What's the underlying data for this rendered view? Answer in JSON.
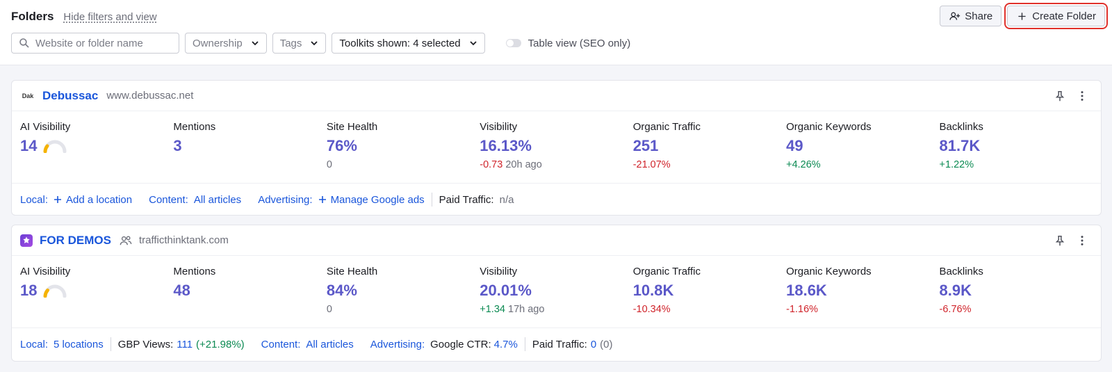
{
  "header": {
    "title": "Folders",
    "hide_link": "Hide filters and view",
    "share_label": "Share",
    "create_label": "Create Folder"
  },
  "filters": {
    "search_placeholder": "Website or folder name",
    "ownership": "Ownership",
    "tags": "Tags",
    "toolkits": "Toolkits shown: 4 selected",
    "table_view": "Table view (SEO only)"
  },
  "colors": {
    "accent": "#1a56db",
    "metric": "#5b58c8",
    "negative": "#d0242b",
    "positive": "#0b8a52",
    "highlight": "#e0312b"
  },
  "folders": [
    {
      "name": "Debussac",
      "logo": "Dak",
      "domain": "www.debussac.net",
      "metrics": {
        "ai_label": "AI Visibility",
        "ai_value": "14",
        "mentions_label": "Mentions",
        "mentions_value": "3",
        "health_label": "Site Health",
        "health_value": "76%",
        "health_sub": "0",
        "vis_label": "Visibility",
        "vis_value": "16.13%",
        "vis_change": "-0.73",
        "vis_time": "20h ago",
        "traffic_label": "Organic Traffic",
        "traffic_value": "251",
        "traffic_change": "-21.07%",
        "kw_label": "Organic Keywords",
        "kw_value": "49",
        "kw_change": "+4.26%",
        "bl_label": "Backlinks",
        "bl_value": "81.7K",
        "bl_change": "+1.22%"
      },
      "footer": {
        "local_label": "Local:",
        "local_value": "Add a location",
        "content_label": "Content:",
        "content_value": "All articles",
        "ads_label": "Advertising:",
        "ads_value": "Manage Google ads",
        "paid_label": "Paid Traffic:",
        "paid_value": "n/a"
      }
    },
    {
      "name": "FOR DEMOS",
      "domain": "trafficthinktank.com",
      "metrics": {
        "ai_label": "AI Visibility",
        "ai_value": "18",
        "mentions_label": "Mentions",
        "mentions_value": "48",
        "health_label": "Site Health",
        "health_value": "84%",
        "health_sub": "0",
        "vis_label": "Visibility",
        "vis_value": "20.01%",
        "vis_change": "+1.34",
        "vis_time": "17h ago",
        "traffic_label": "Organic Traffic",
        "traffic_value": "10.8K",
        "traffic_change": "-10.34%",
        "kw_label": "Organic Keywords",
        "kw_value": "18.6K",
        "kw_change": "-1.16%",
        "bl_label": "Backlinks",
        "bl_value": "8.9K",
        "bl_change": "-6.76%"
      },
      "footer": {
        "local_label": "Local:",
        "local_value": "5 locations",
        "gbp_label": "GBP Views:",
        "gbp_value": "111",
        "gbp_change": "(+21.98%)",
        "content_label": "Content:",
        "content_value": "All articles",
        "ads_label": "Advertising:",
        "ctr_label": "Google CTR:",
        "ctr_value": "4.7%",
        "paid_label": "Paid Traffic:",
        "paid_value": "0",
        "paid_extra": "(0)"
      }
    }
  ]
}
